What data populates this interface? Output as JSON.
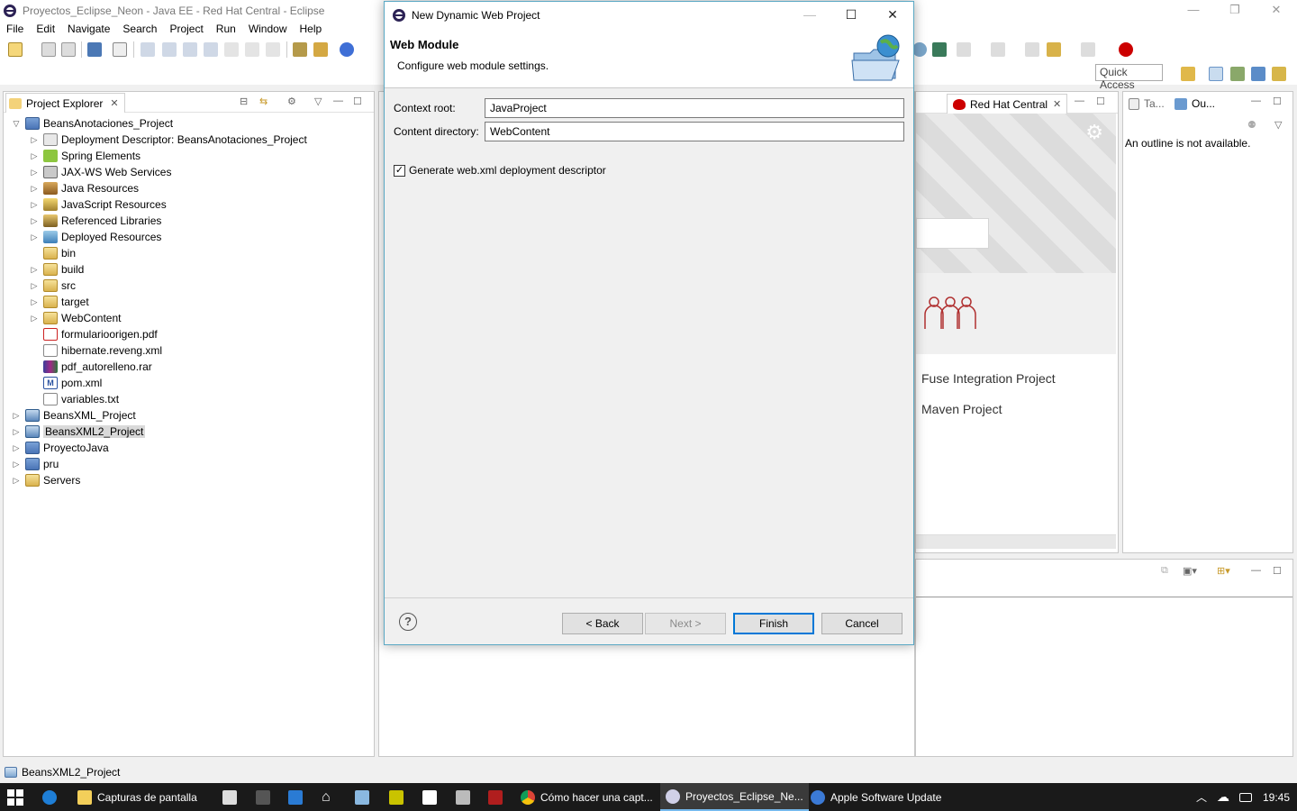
{
  "eclipse": {
    "title": "Proyectos_Eclipse_Neon - Java EE - Red Hat Central - Eclipse",
    "window_controls": [
      "—",
      "❐",
      "✕"
    ],
    "menu": [
      "File",
      "Edit",
      "Navigate",
      "Search",
      "Project",
      "Run",
      "Window",
      "Help"
    ],
    "quick_access": "Quick Access"
  },
  "explorer": {
    "tab_label": "Project Explorer",
    "tree": [
      {
        "label": "BeansAnotaciones_Project",
        "icon": "project-icon",
        "level": 0,
        "arrow": "expanded"
      },
      {
        "label": "Deployment Descriptor: BeansAnotaciones_Project",
        "icon": "descriptor-icon",
        "level": 1,
        "arrow": "collapsed"
      },
      {
        "label": "Spring Elements",
        "icon": "spring-icon",
        "level": 1,
        "arrow": "collapsed"
      },
      {
        "label": "JAX-WS Web Services",
        "icon": "webservice-icon",
        "level": 1,
        "arrow": "collapsed"
      },
      {
        "label": "Java Resources",
        "icon": "java-resources-icon",
        "level": 1,
        "arrow": "collapsed"
      },
      {
        "label": "JavaScript Resources",
        "icon": "javascript-icon",
        "level": 1,
        "arrow": "collapsed"
      },
      {
        "label": "Referenced Libraries",
        "icon": "library-icon",
        "level": 1,
        "arrow": "collapsed"
      },
      {
        "label": "Deployed Resources",
        "icon": "deployed-icon",
        "level": 1,
        "arrow": "collapsed"
      },
      {
        "label": "bin",
        "icon": "folder-icon",
        "level": 1,
        "arrow": "none"
      },
      {
        "label": "build",
        "icon": "folder-icon",
        "level": 1,
        "arrow": "collapsed"
      },
      {
        "label": "src",
        "icon": "folder-icon",
        "level": 1,
        "arrow": "collapsed"
      },
      {
        "label": "target",
        "icon": "folder-icon",
        "level": 1,
        "arrow": "collapsed"
      },
      {
        "label": "WebContent",
        "icon": "folder-icon",
        "level": 1,
        "arrow": "collapsed"
      },
      {
        "label": "formularioorigen.pdf",
        "icon": "pdf-icon",
        "level": 1,
        "arrow": "none"
      },
      {
        "label": "hibernate.reveng.xml",
        "icon": "xml-icon",
        "level": 1,
        "arrow": "none"
      },
      {
        "label": "pdf_autorelleno.rar",
        "icon": "rar-icon",
        "level": 1,
        "arrow": "none"
      },
      {
        "label": "pom.xml",
        "icon": "pom-icon",
        "level": 1,
        "arrow": "none"
      },
      {
        "label": "variables.txt",
        "icon": "text-file-icon",
        "level": 1,
        "arrow": "none"
      },
      {
        "label": "BeansXML_Project",
        "icon": "project-folder-icon",
        "level": 0,
        "arrow": "collapsed"
      },
      {
        "label": "BeansXML2_Project",
        "icon": "project-folder-icon",
        "level": 0,
        "arrow": "collapsed",
        "selected": true
      },
      {
        "label": "ProyectoJava",
        "icon": "project-icon",
        "level": 0,
        "arrow": "collapsed"
      },
      {
        "label": "pru",
        "icon": "project-icon",
        "level": 0,
        "arrow": "collapsed"
      },
      {
        "label": "Servers",
        "icon": "folder-icon",
        "level": 0,
        "arrow": "collapsed"
      }
    ]
  },
  "redhat": {
    "tab_label": "Red Hat Central",
    "links": [
      "Fuse Integration Project",
      "Maven Project"
    ]
  },
  "outline": {
    "tab_tasks": "Ta...",
    "tab_outline": "Ou...",
    "message": "An outline is not available."
  },
  "status": {
    "selected": "BeansXML2_Project"
  },
  "taskbar": {
    "apps": [
      {
        "label": "Capturas de pantalla",
        "icon": "folder-icon"
      },
      {
        "label": "Cómo hacer una capt...",
        "icon": "chrome-icon"
      },
      {
        "label": "Proyectos_Eclipse_Ne...",
        "icon": "eclipse-icon",
        "active": true
      },
      {
        "label": "Apple Software Update",
        "icon": "apple-update-icon"
      }
    ],
    "time": "19:45"
  },
  "dialog": {
    "title": "New Dynamic Web Project",
    "header_title": "Web Module",
    "header_desc": "Configure web module settings.",
    "context_root_label": "Context root:",
    "context_root_value": "JavaProject",
    "content_dir_label": "Content directory:",
    "content_dir_value": "WebContent",
    "generate_label": "Generate web.xml deployment descriptor",
    "generate_checked": true,
    "buttons": {
      "back": "< Back",
      "next": "Next >",
      "finish": "Finish",
      "cancel": "Cancel"
    },
    "help": "?"
  },
  "colors": {
    "accent": "#0078d7",
    "dialog_border": "#5aa8c4",
    "redhat": "#cc0000",
    "taskbar": "#1a1a1a"
  }
}
